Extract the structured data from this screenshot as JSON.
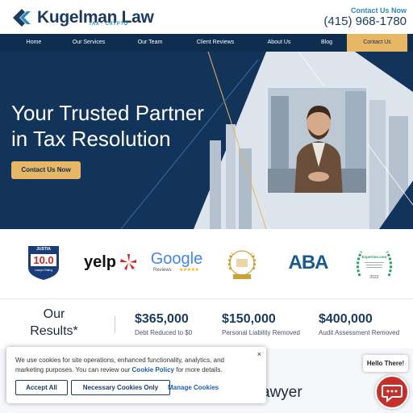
{
  "header": {
    "brand": "Kugelman Law",
    "tagline": "TAX · CRYPTO",
    "contact_link": "Contact Us Now",
    "phone": "(415) 968-1780"
  },
  "nav": {
    "items": [
      "Home",
      "Our Services",
      "Our Team",
      "Client Reviews",
      "About Us",
      "Blog",
      "Contact Us"
    ]
  },
  "hero": {
    "title_line1": "Your Trusted Partner",
    "title_line2": "in Tax Resolution",
    "cta": "Contact Us Now"
  },
  "badges": {
    "justia_top": "JUSTIA",
    "justia_score": "10.0",
    "justia_bottom": "Lawyer Rating",
    "yelp": "yelp",
    "google": "Google",
    "google_sub": "Reviews",
    "aba": "ABA",
    "expertise_name": "Expertise.com",
    "expertise_year": "2022"
  },
  "results": {
    "title_line1": "Our",
    "title_line2": "Results*",
    "stats": [
      {
        "value": "$365,000",
        "label": "Debt Reduced to $0"
      },
      {
        "value": "$150,000",
        "label": "Personal Liability Removed"
      },
      {
        "value": "$400,000",
        "label": "Audit Assessment Removed"
      }
    ]
  },
  "section_fragment": "awyer",
  "cookie": {
    "text_before": "We use cookies for site operations, enhanced functionality, analytics, and marketing purposes. You can review our ",
    "policy_link": "Cookie Policy",
    "text_after": " for more details.",
    "accept": "Accept All",
    "necessary": "Necessary Cookies Only",
    "manage": "Manage Cookies",
    "close": "×"
  },
  "chat": {
    "greeting": "Hello There!"
  },
  "colors": {
    "navy": "#0f2d4f",
    "gold": "#e8b765",
    "accent_blue": "#2c8ab8",
    "chat_red": "#c5302d"
  }
}
